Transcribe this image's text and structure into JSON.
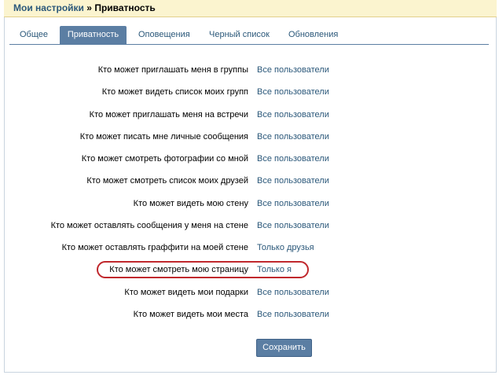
{
  "breadcrumb": {
    "parent": "Мои настройки",
    "separator": "»",
    "current": "Приватность"
  },
  "tabs": [
    {
      "label": "Общее",
      "active": false
    },
    {
      "label": "Приватность",
      "active": true
    },
    {
      "label": "Оповещения",
      "active": false
    },
    {
      "label": "Черный список",
      "active": false
    },
    {
      "label": "Обновления",
      "active": false
    }
  ],
  "settings": [
    {
      "label": "Кто может приглашать меня в группы",
      "value": "Все пользователи"
    },
    {
      "label": "Кто может видеть список моих групп",
      "value": "Все пользователи"
    },
    {
      "label": "Кто может приглашать меня на встречи",
      "value": "Все пользователи"
    },
    {
      "label": "Кто может писать мне личные сообщения",
      "value": "Все пользователи"
    },
    {
      "label": "Кто может смотреть фотографии со мной",
      "value": "Все пользователи"
    },
    {
      "label": "Кто может смотреть список моих друзей",
      "value": "Все пользователи"
    },
    {
      "label": "Кто может видеть мою стену",
      "value": "Все пользователи"
    },
    {
      "label": "Кто может оставлять сообщения у меня на стене",
      "value": "Все пользователи"
    },
    {
      "label": "Кто может оставлять граффити на моей стене",
      "value": "Только друзья"
    },
    {
      "label": "Кто может смотреть мою страницу",
      "value": "Только я"
    },
    {
      "label": "Кто может видеть мои подарки",
      "value": "Все пользователи"
    },
    {
      "label": "Кто может видеть мои места",
      "value": "Все пользователи"
    }
  ],
  "save_button": "Сохранить",
  "colors": {
    "link": "#2b587a",
    "tab_active_bg": "#5b7ea3",
    "header_bg": "#fbf4cf",
    "highlight": "#c0282d"
  }
}
